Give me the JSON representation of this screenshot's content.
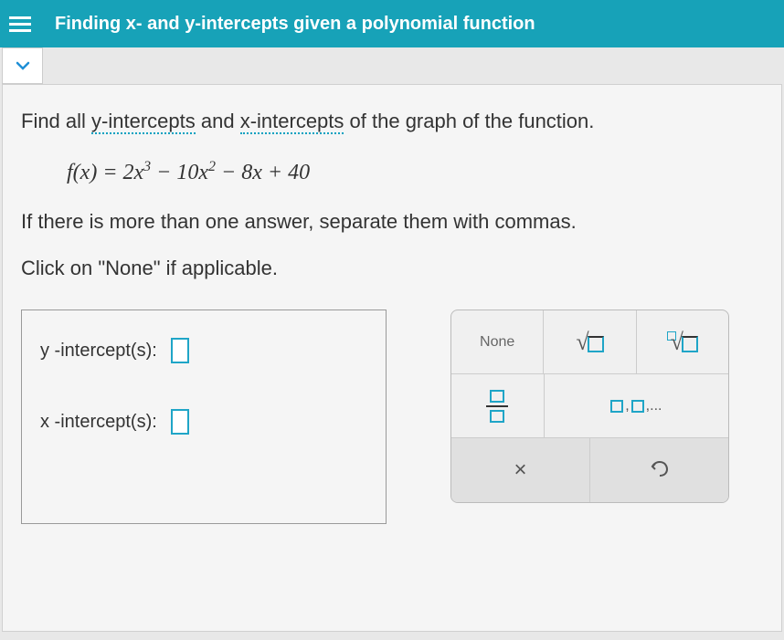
{
  "header": {
    "title": "Finding x- and y-intercepts given a polynomial function"
  },
  "question": {
    "part1": "Find all ",
    "link1": "y-intercepts",
    "part2": " and ",
    "link2": "x-intercepts",
    "part3": " of the graph of the function."
  },
  "formula_parts": {
    "fx": "f(x)",
    "eq": " = 2x",
    "e1": "3",
    "t2": " − 10x",
    "e2": "2",
    "t3": " − 8x + 40"
  },
  "instruction1": "If there is more than one answer, separate them with commas.",
  "instruction2": "Click on \"None\" if applicable.",
  "answers": {
    "y_label": "y -intercept(s):",
    "x_label": "x -intercept(s):"
  },
  "toolbox": {
    "none": "None",
    "close": "×",
    "commas": ",...",
    "comma": ","
  }
}
